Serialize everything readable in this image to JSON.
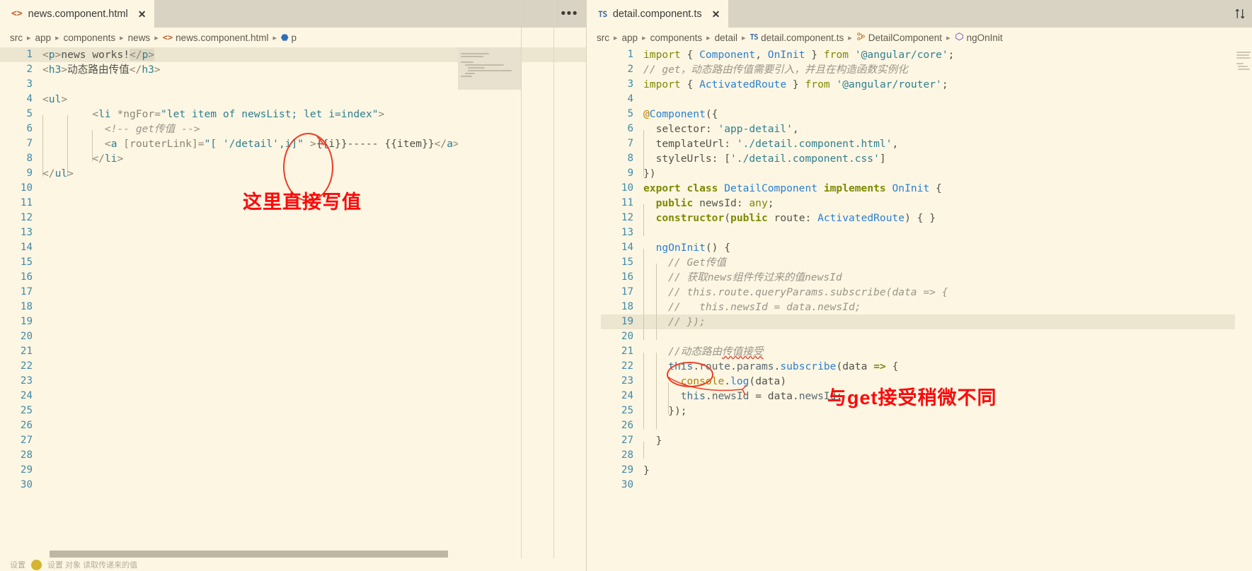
{
  "left_pane": {
    "tab": {
      "icon": "html-tag-icon",
      "icon_glyph": "<>",
      "label": "news.component.html",
      "close": "✕"
    },
    "tab_actions_label": "•••",
    "breadcrumb": [
      {
        "label": "src",
        "icon": ""
      },
      {
        "label": "app",
        "icon": ""
      },
      {
        "label": "components",
        "icon": ""
      },
      {
        "label": "news",
        "icon": ""
      },
      {
        "label": "news.component.html",
        "icon": "html-tag-icon",
        "icon_glyph": "<>"
      },
      {
        "label": "p",
        "icon": "element-cube-icon",
        "icon_glyph": "⬣"
      }
    ],
    "breadcrumb_separator": "▸",
    "line_count": 30,
    "code_lines": [
      {
        "n": 1,
        "text": "<p>news works!</p>"
      },
      {
        "n": 2,
        "text": "<h3>动态路由传值</h3>"
      },
      {
        "n": 3,
        "text": ""
      },
      {
        "n": 4,
        "text": "<ul>"
      },
      {
        "n": 5,
        "text": "        <li *ngFor=\"let item of newsList; let i=index\">"
      },
      {
        "n": 6,
        "text": "          <!-- get传值 -->"
      },
      {
        "n": 7,
        "text": "          <a [routerLink]=\"[ '/detail',i]\" >{{i}}----- {{item}}</a>"
      },
      {
        "n": 8,
        "text": "        </li>"
      },
      {
        "n": 9,
        "text": "</ul>"
      },
      {
        "n": 10,
        "text": ""
      },
      {
        "n": 11,
        "text": ""
      },
      {
        "n": 12,
        "text": ""
      },
      {
        "n": 13,
        "text": ""
      },
      {
        "n": 14,
        "text": ""
      },
      {
        "n": 15,
        "text": ""
      },
      {
        "n": 16,
        "text": ""
      },
      {
        "n": 17,
        "text": ""
      },
      {
        "n": 18,
        "text": ""
      },
      {
        "n": 19,
        "text": ""
      },
      {
        "n": 20,
        "text": ""
      },
      {
        "n": 21,
        "text": ""
      },
      {
        "n": 22,
        "text": ""
      },
      {
        "n": 23,
        "text": ""
      },
      {
        "n": 24,
        "text": ""
      },
      {
        "n": 25,
        "text": ""
      },
      {
        "n": 26,
        "text": ""
      },
      {
        "n": 27,
        "text": ""
      },
      {
        "n": 28,
        "text": ""
      },
      {
        "n": 29,
        "text": ""
      },
      {
        "n": 30,
        "text": ""
      }
    ],
    "annotation": {
      "text": "这里直接写值",
      "color": "#fa0a0a",
      "circle_target": ",i"
    }
  },
  "right_pane": {
    "tab": {
      "icon": "typescript-icon",
      "icon_glyph": "TS",
      "label": "detail.component.ts",
      "close": "✕"
    },
    "split_editor_icon": "split-editor-icon",
    "breadcrumb": [
      {
        "label": "src",
        "icon": ""
      },
      {
        "label": "app",
        "icon": ""
      },
      {
        "label": "components",
        "icon": ""
      },
      {
        "label": "detail",
        "icon": ""
      },
      {
        "label": "detail.component.ts",
        "icon": "typescript-icon",
        "icon_glyph": "TS"
      },
      {
        "label": "DetailComponent",
        "icon": "class-icon",
        "icon_glyph": "⬚"
      },
      {
        "label": "ngOnInit",
        "icon": "method-icon",
        "icon_glyph": "⬡"
      }
    ],
    "breadcrumb_separator": "▸",
    "line_count": 30,
    "highlighted_line": 19,
    "code_lines": [
      {
        "n": 1,
        "text": "import { Component, OnInit } from '@angular/core';"
      },
      {
        "n": 2,
        "text": "// get，动态路由传值需要引入，并且在构造函数实例化"
      },
      {
        "n": 3,
        "text": "import { ActivatedRoute } from '@angular/router';"
      },
      {
        "n": 4,
        "text": ""
      },
      {
        "n": 5,
        "text": "@Component({"
      },
      {
        "n": 6,
        "text": "  selector: 'app-detail',"
      },
      {
        "n": 7,
        "text": "  templateUrl: './detail.component.html',"
      },
      {
        "n": 8,
        "text": "  styleUrls: ['./detail.component.css']"
      },
      {
        "n": 9,
        "text": "})"
      },
      {
        "n": 10,
        "text": "export class DetailComponent implements OnInit {"
      },
      {
        "n": 11,
        "text": "  public newsId: any;"
      },
      {
        "n": 12,
        "text": "  constructor(public route: ActivatedRoute) { }"
      },
      {
        "n": 13,
        "text": ""
      },
      {
        "n": 14,
        "text": "  ngOnInit() {"
      },
      {
        "n": 15,
        "text": "    // Get传值"
      },
      {
        "n": 16,
        "text": "    // 获取news组件传过来的值newsId"
      },
      {
        "n": 17,
        "text": "    // this.route.queryParams.subscribe(data => {"
      },
      {
        "n": 18,
        "text": "    //   this.newsId = data.newsId;"
      },
      {
        "n": 19,
        "text": "    // });"
      },
      {
        "n": 20,
        "text": ""
      },
      {
        "n": 21,
        "text": "    //动态路由传值接受"
      },
      {
        "n": 22,
        "text": "    this.route.params.subscribe(data => {"
      },
      {
        "n": 23,
        "text": "      console.log(data)"
      },
      {
        "n": 24,
        "text": "      this.newsId = data.newsId;"
      },
      {
        "n": 25,
        "text": "    });"
      },
      {
        "n": 26,
        "text": ""
      },
      {
        "n": 27,
        "text": "  }"
      },
      {
        "n": 28,
        "text": ""
      },
      {
        "n": 29,
        "text": "}"
      },
      {
        "n": 30,
        "text": ""
      }
    ],
    "annotation": {
      "text": "与 get接受稍微不同",
      "display_text": "与get接受稍微不同",
      "color": "#fa0a0a",
      "circle_target": "params"
    }
  },
  "statusbar": {
    "text": "设置  对象  读取传递来的值",
    "dot_color": "#d4b430"
  }
}
